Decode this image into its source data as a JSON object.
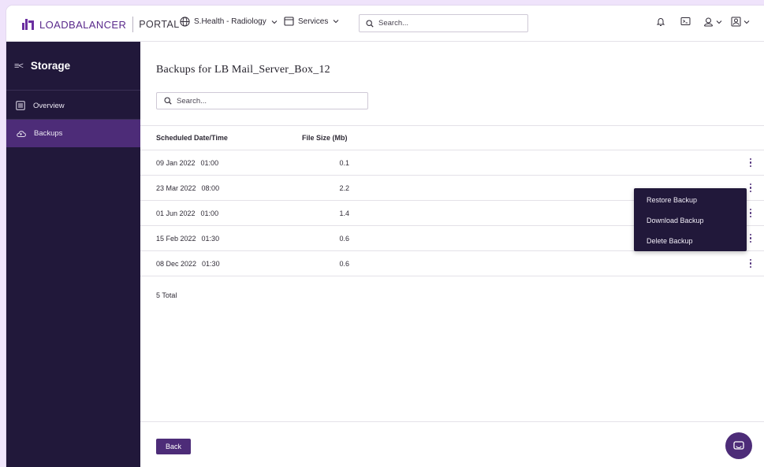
{
  "header": {
    "brand": "LOADBALANCER",
    "portal": "PORTAL",
    "org_selector": "S.Health - Radiology",
    "services_menu": "Services",
    "search_placeholder": "Search..."
  },
  "sidebar": {
    "title": "Storage",
    "collapse_glyph": "≡<",
    "items": [
      {
        "label": "Overview",
        "icon": "list-icon",
        "active": false
      },
      {
        "label": "Backups",
        "icon": "cloud-icon",
        "active": true
      }
    ]
  },
  "main": {
    "title": "Backups for LB Mail_Server_Box_12",
    "search_placeholder": "Search...",
    "table": {
      "columns": [
        "Scheduled Date/Time",
        "File Size (Mb)"
      ],
      "rows": [
        {
          "date": "09 Jan 2022",
          "time": "01:00",
          "size": "0.1"
        },
        {
          "date": "23 Mar 2022",
          "time": "08:00",
          "size": "2.2"
        },
        {
          "date": "01 Jun 2022",
          "time": "01:00",
          "size": "1.4"
        },
        {
          "date": "15 Feb 2022",
          "time": "01:30",
          "size": "0.6"
        },
        {
          "date": "08 Dec 2022",
          "time": "01:30",
          "size": "0.6"
        }
      ]
    },
    "total": "5 Total",
    "row_menu": {
      "items": [
        "Restore Backup",
        "Download Backup",
        "Delete Backup"
      ]
    }
  },
  "footer": {
    "back_label": "Back"
  },
  "colors": {
    "primary": "#4d2c78",
    "sidebar_bg": "#21183a",
    "page_bg": "#efe3fb"
  }
}
